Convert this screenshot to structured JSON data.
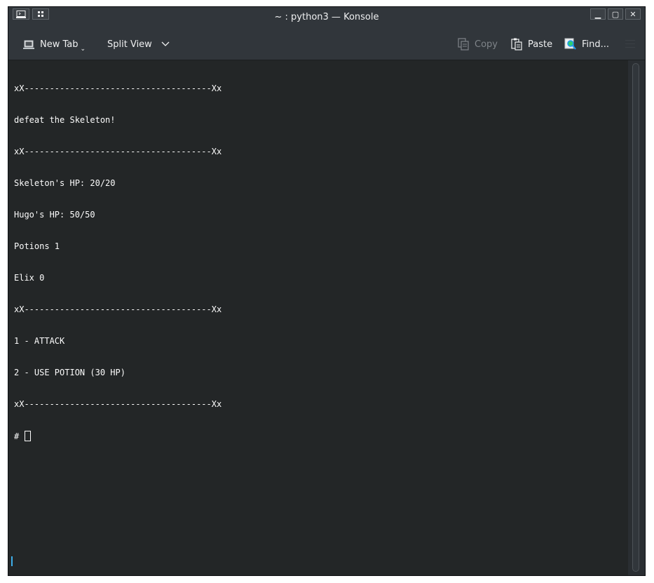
{
  "window": {
    "title": "~ : python3 — Konsole"
  },
  "titlebar_buttons": {
    "left": [
      "konsole-app-icon",
      "pin-icon"
    ],
    "minimize": "▁",
    "maximize": "▢",
    "close": "✕"
  },
  "toolbar": {
    "new_tab": "New Tab",
    "split_view": "Split View",
    "copy": "Copy",
    "paste": "Paste",
    "find": "Find..."
  },
  "terminal": {
    "lines": [
      "xX-------------------------------------Xx",
      "defeat the Skeleton!",
      "xX-------------------------------------Xx",
      "Skeleton's HP: 20/20",
      "Hugo's HP: 50/50",
      "Potions 1",
      "Elix 0",
      "xX-------------------------------------Xx",
      "1 - ATTACK",
      "2 - USE POTION (30 HP)",
      "xX-------------------------------------Xx"
    ],
    "prompt": "# "
  },
  "colors": {
    "background": "#232627",
    "foreground": "#fcfcfc",
    "chrome": "#31363b",
    "accent": "#3daee9"
  }
}
